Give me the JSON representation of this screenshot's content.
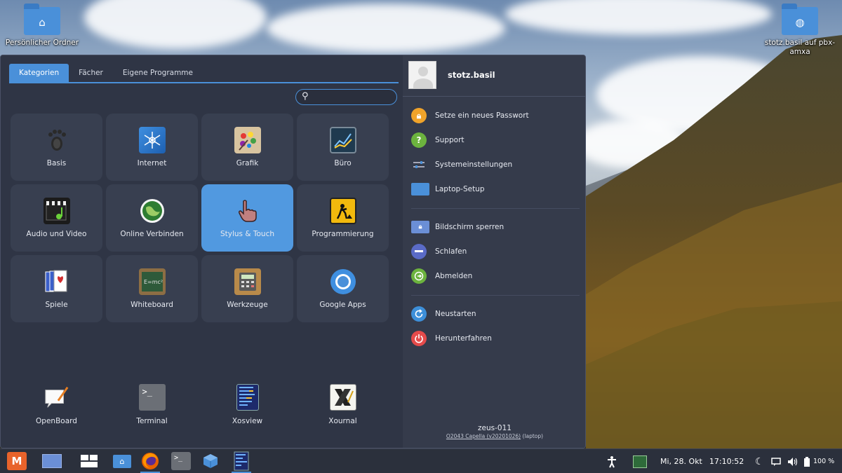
{
  "desktop": {
    "icons": [
      {
        "label": "Persönlicher Ordner",
        "glyph": "⌂"
      },
      {
        "label": "stotz.basil auf pbx-amxa",
        "glyph": "◍"
      }
    ]
  },
  "menu": {
    "tabs": [
      {
        "label": "Kategorien"
      },
      {
        "label": "Fächer"
      },
      {
        "label": "Eigene Programme"
      }
    ],
    "search": {
      "placeholder": ""
    },
    "categories": [
      {
        "label": "Basis",
        "icon": "gnome-foot-icon"
      },
      {
        "label": "Internet",
        "icon": "network-icon"
      },
      {
        "label": "Grafik",
        "icon": "paint-palette-icon"
      },
      {
        "label": "Büro",
        "icon": "chart-icon"
      },
      {
        "label": "Audio und Video",
        "icon": "clapperboard-icon"
      },
      {
        "label": "Online Verbinden",
        "icon": "globe-icon"
      },
      {
        "label": "Stylus & Touch",
        "icon": "pointing-hand-icon"
      },
      {
        "label": "Programmierung",
        "icon": "construction-sign-icon"
      },
      {
        "label": "Spiele",
        "icon": "playing-cards-icon"
      },
      {
        "label": "Whiteboard",
        "icon": "chalkboard-icon"
      },
      {
        "label": "Werkzeuge",
        "icon": "calculator-icon"
      },
      {
        "label": "Google Apps",
        "icon": "chrome-icon"
      }
    ],
    "selected_category": "Stylus & Touch",
    "favorites": [
      {
        "label": "OpenBoard",
        "icon": "openboard-icon"
      },
      {
        "label": "Terminal",
        "icon": "terminal-icon"
      },
      {
        "label": "Xosview",
        "icon": "xosview-icon"
      },
      {
        "label": "Xournal",
        "icon": "xournal-icon"
      }
    ],
    "user": {
      "name": "stotz.basil"
    },
    "actions": [
      {
        "label": "Setze ein neues Passwort",
        "icon": "lock-icon",
        "color": "#f0a32a"
      },
      {
        "label": "Support",
        "icon": "question-icon",
        "color": "#6cb33e"
      },
      {
        "label": "Systemeinstellungen",
        "icon": "sliders-icon",
        "color": "#353b4b"
      },
      {
        "label": "Laptop-Setup",
        "icon": "laptop-icon",
        "color": "#4a90d9"
      },
      {
        "label": "Bildschirm sperren",
        "icon": "lock-screen-icon",
        "color": "#6b8fd6"
      },
      {
        "label": "Schlafen",
        "icon": "sleep-icon",
        "color": "#5a6bc7"
      },
      {
        "label": "Abmelden",
        "icon": "logout-icon",
        "color": "#6cb33e"
      },
      {
        "label": "Neustarten",
        "icon": "restart-icon",
        "color": "#3d8fd9"
      },
      {
        "label": "Herunterfahren",
        "icon": "power-icon",
        "color": "#e54b4b"
      }
    ],
    "host": {
      "name": "zeus-011",
      "version_link": "O2043 Capella (v20201026)",
      "version_suffix": " (laptop)"
    }
  },
  "taskbar": {
    "apps": [
      {
        "name": "menu-launcher-icon"
      },
      {
        "name": "show-desktop-icon"
      },
      {
        "name": "window-switcher-icon"
      },
      {
        "name": "file-manager-icon"
      },
      {
        "name": "firefox-icon"
      },
      {
        "name": "terminal-icon"
      },
      {
        "name": "cube-app-icon"
      },
      {
        "name": "xosview-icon"
      }
    ],
    "clock": {
      "date": "Mi, 28. Okt",
      "time": "17:10:52"
    },
    "battery": "100 %"
  },
  "colors": {
    "accent": "#4a90d9",
    "panel": "#2f3545",
    "selected_tile": "#5199e0"
  }
}
